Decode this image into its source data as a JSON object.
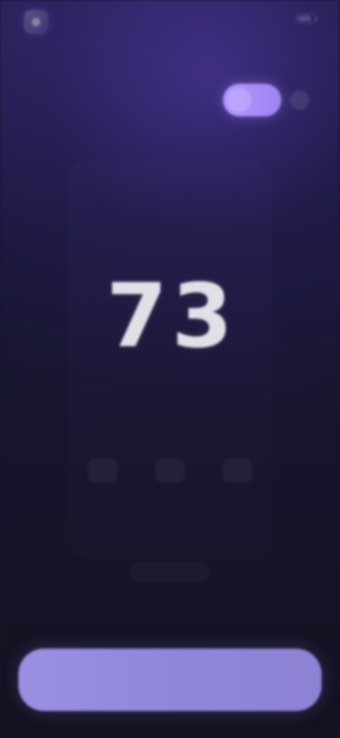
{
  "topbar": {
    "brand_name": "",
    "status_time": ""
  },
  "header": {
    "subtitle": ""
  },
  "mode_toggle": {
    "label": "",
    "secondary_label": ""
  },
  "panel": {
    "title": "",
    "subtitle": "",
    "reading": "73"
  },
  "stats": [
    {
      "value": "",
      "label": ""
    },
    {
      "value": "",
      "label": ""
    },
    {
      "value": "",
      "label": ""
    }
  ],
  "details": {
    "label": ""
  },
  "bottom_action": {
    "label": ""
  },
  "colors": {
    "accent_primary": "#a58cf5",
    "accent_button": "#938ae0",
    "background_top": "#241d4d",
    "background_bottom": "#13121f"
  },
  "icons": {
    "brand": "app-logo-icon",
    "battery": "battery-icon",
    "secondary_toggle": "dot-icon"
  }
}
